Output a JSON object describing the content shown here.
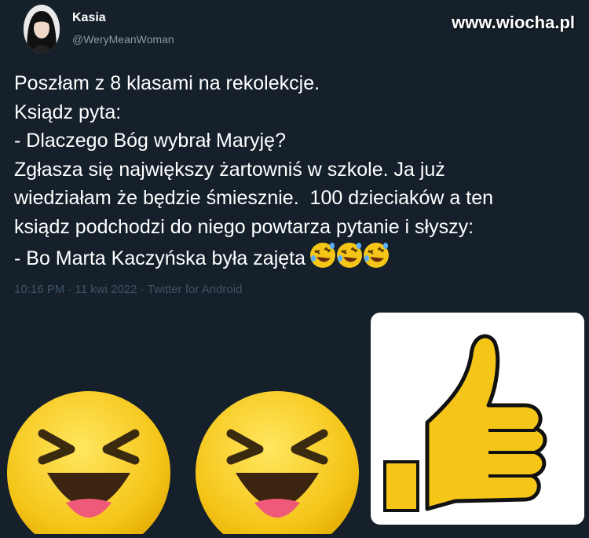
{
  "author": {
    "name": "Kasia",
    "handle": "@WeryMeanWoman"
  },
  "watermark": "www.wiocha.pl",
  "tweet": {
    "lines": [
      "Poszłam z 8 klasami na rekolekcje.",
      "Ksiądz pyta:",
      "- Dlaczego Bóg wybrał Maryję?",
      "Zgłasza się największy żartowniś w szkole. Ja już",
      "wiedziałam że będzie śmiesznie.  100 dzieciaków a ten",
      "ksiądz podchodzi do niego powtarza pytanie i słyszy:",
      "- Bo Marta Kaczyńska była zajęta"
    ],
    "trailing_emoji": [
      "rolling-on-floor-laughing-icon",
      "rolling-on-floor-laughing-icon",
      "rolling-on-floor-laughing-icon"
    ],
    "meta": "10:16 PM · 11 kwi 2022 · Twitter for Android"
  },
  "stickers": [
    "laughing-face-icon",
    "laughing-face-icon",
    "thumbs-up-icon"
  ],
  "colors": {
    "background": "#15202b",
    "text": "#ffffff",
    "muted": "#8899a6",
    "meta": "#3e5366",
    "emoji_yellow": "#f5c518"
  }
}
